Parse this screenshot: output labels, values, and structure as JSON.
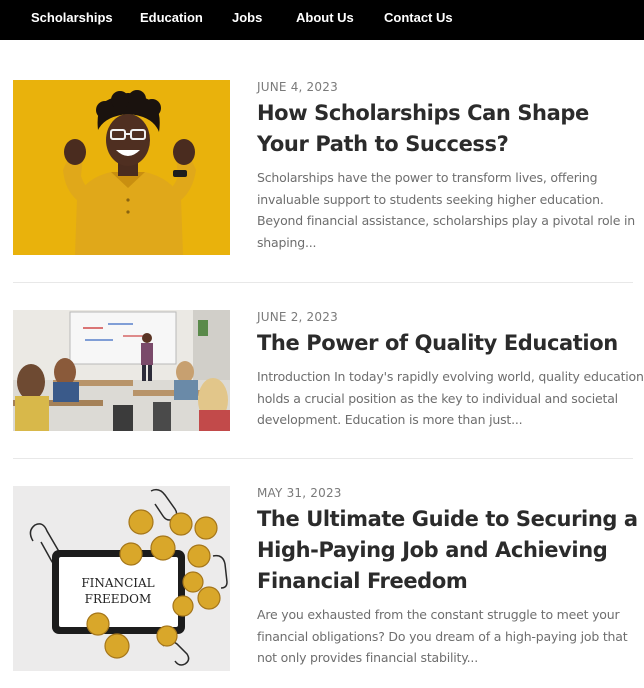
{
  "nav": {
    "items": [
      "Scholarships",
      "Education",
      "Jobs",
      "About Us",
      "Contact Us"
    ]
  },
  "posts": [
    {
      "date": "JUNE 4, 2023",
      "title": "How Scholarships Can Shape Your Path to Success?",
      "excerpt": "Scholarships have the power to transform lives, offering invaluable support to students seeking higher education. Beyond financial assistance, scholarships play a pivotal role in shaping..."
    },
    {
      "date": "JUNE 2, 2023",
      "title": "The Power of Quality Education",
      "excerpt": "Introduction In today's rapidly evolving world, quality education holds a crucial position as the key to individual and societal development. Education is more than just..."
    },
    {
      "date": "MAY 31, 2023",
      "title": "The Ultimate Guide to Securing a High-Paying Job and Achieving Financial Freedom",
      "excerpt": "Are you exhausted from the constant struggle to meet your financial obligations? Do you dream of a high-paying job that not only provides financial stability...",
      "image_text": [
        "FINANCIAL",
        "FREEDOM"
      ]
    }
  ],
  "colors": {
    "nav_bg": "#000000",
    "nav_text": "#ffffff",
    "yellow_bg": "#e9b20c",
    "shirt": "#e0a81a"
  }
}
